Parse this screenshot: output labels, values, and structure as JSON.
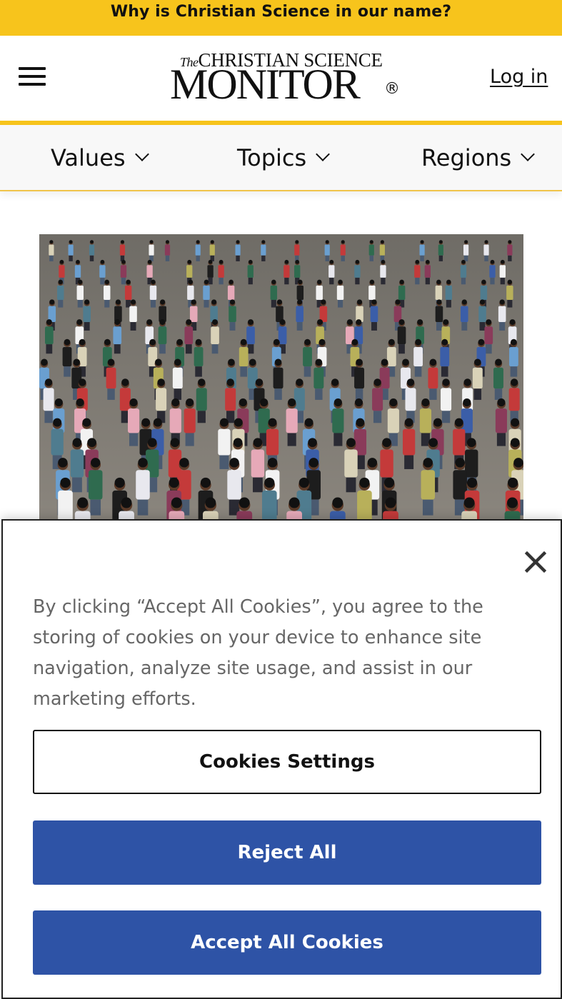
{
  "promo_banner": {
    "text": "Why is Christian Science in our name?"
  },
  "header": {
    "menu_icon": "hamburger-menu-icon",
    "logo": {
      "line1_the": "The",
      "line1": "CHRISTIAN SCIENCE",
      "line2": "MONITOR",
      "registered": "®"
    },
    "login_label": "Log in"
  },
  "nav": {
    "items": [
      {
        "label": "Values"
      },
      {
        "label": "Topics"
      },
      {
        "label": "Regions"
      }
    ]
  },
  "hero": {
    "image_description": "crowd-of-protesters-photo"
  },
  "cookie_dialog": {
    "text": "By clicking “Accept All Cookies”, you agree to the storing of cookies on your device to enhance site navigation, analyze site usage, and assist in our marketing efforts.",
    "close_icon": "close-icon",
    "settings_label": "Cookies Settings",
    "reject_label": "Reject All",
    "accept_label": "Accept All Cookies"
  },
  "colors": {
    "brand_gold": "#f7c41c",
    "button_blue": "#2e53a6"
  }
}
